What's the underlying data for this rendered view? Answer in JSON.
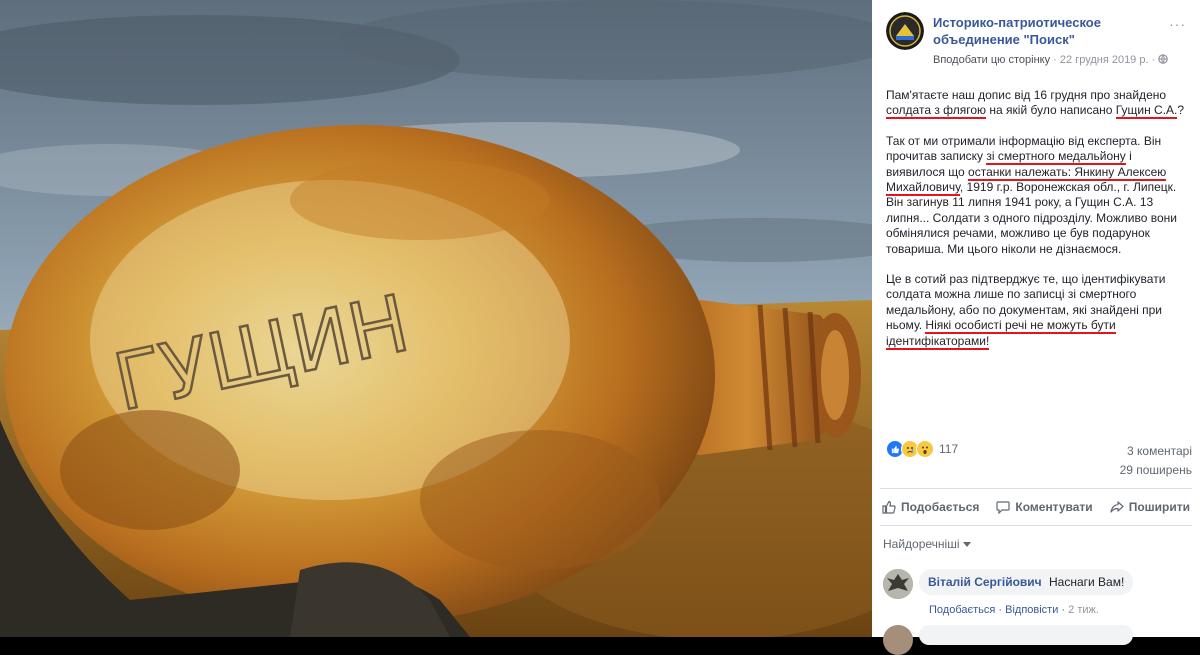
{
  "post": {
    "page_name": "Историко-патриотическое объединение \"Поиск\"",
    "like_page": "Вподобати цю сторінку",
    "date": "22 грудня 2019 р.",
    "menu": "···",
    "p1": {
      "a": "Пам'ятаєте наш допис від 16 грудня про знайдено ",
      "u1": "солдата з флягою",
      "b": " на якій було написано ",
      "u2": "Гущин С.А.",
      "c": "?"
    },
    "p2": {
      "a": "Так от ми отримали інформацію від експерта. Він прочитав записку ",
      "u1": "зі смертного медальйону",
      "b": " і виявилося що ",
      "u2": "останки належать: Янкину Алексею Михайловичу",
      "c": ", 1919 г.р. Воронежская обл., г. Липецк. Він загинув 11 липня 1941 року, а Гущин С.А. 13 липня... Солдати з одного підрозділу. Можливо вони обмінялися речами, можливо це був подарунок товариша. Ми цього ніколи не дізнаємося."
    },
    "p3": {
      "a": "Це в сотий раз підтверджує те, що ідентифікувати солдата можна лише по записці зі смертного медальйону, або по документам, які знайдені при ньому. ",
      "u1": "Ніякі особисті речі не можуть бути ідентифікаторами!"
    },
    "reactions_count": "117",
    "comments_count": "3 коментарі",
    "shares_count": "29 поширень"
  },
  "actions": {
    "like": "Подобається",
    "comment": "Коментувати",
    "share": "Поширити"
  },
  "sort": "Найдоречніші",
  "comments": [
    {
      "author": "Віталій Сергійович",
      "text": "Наснаги Вам!",
      "like": "Подобається",
      "reply": "Відповісти",
      "time": "2 тиж."
    }
  ],
  "photo": {
    "flask_inscription": "ГУЩИН"
  },
  "colors": {
    "link": "#385898",
    "underline": "#e0161f",
    "sky": "#7c8e9c",
    "rust": "#c98a2a"
  }
}
